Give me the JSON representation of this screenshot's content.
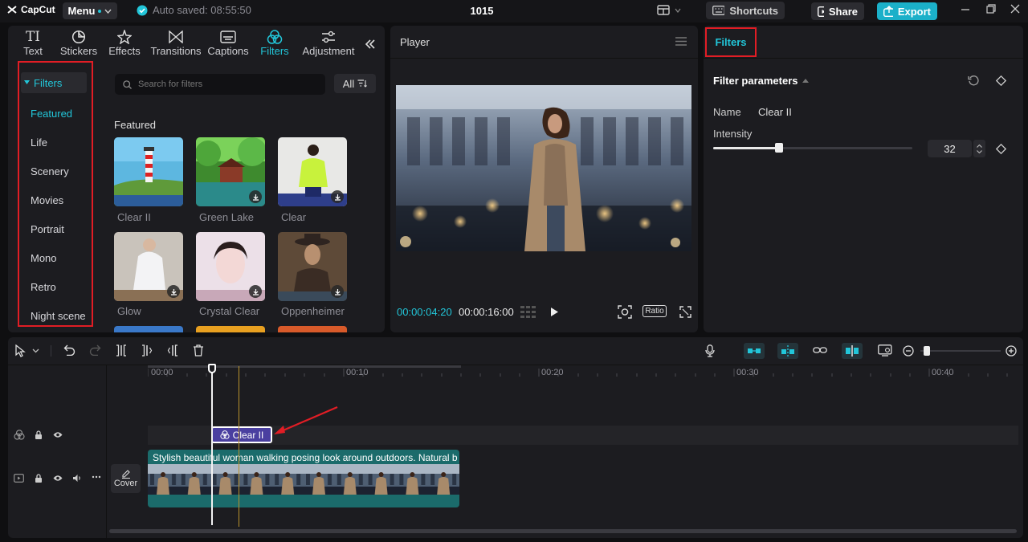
{
  "titlebar": {
    "app_name": "CapCut",
    "menu_label": "Menu",
    "autosave_text": "Auto saved: 08:55:50",
    "project_title": "1015",
    "shortcuts_label": "Shortcuts",
    "share_label": "Share",
    "export_label": "Export"
  },
  "category_tabs": [
    {
      "label": "Text",
      "icon": "text-icon"
    },
    {
      "label": "Stickers",
      "icon": "sticker-icon"
    },
    {
      "label": "Effects",
      "icon": "effects-icon"
    },
    {
      "label": "Transitions",
      "icon": "transitions-icon"
    },
    {
      "label": "Captions",
      "icon": "captions-icon"
    },
    {
      "label": "Filters",
      "icon": "filters-icon",
      "active": true
    },
    {
      "label": "Adjustment",
      "icon": "adjustment-icon"
    }
  ],
  "sidebar": {
    "header": "Filters",
    "items": [
      "Featured",
      "Life",
      "Scenery",
      "Movies",
      "Portrait",
      "Mono",
      "Retro",
      "Night scene"
    ],
    "active_item": "Featured"
  },
  "search": {
    "placeholder": "Search for filters"
  },
  "all_filter_label": "All",
  "section_label": "Featured",
  "filters": [
    {
      "label": "Clear II",
      "downloaded": true
    },
    {
      "label": "Green Lake",
      "downloaded": false
    },
    {
      "label": "Clear",
      "downloaded": false
    },
    {
      "label": "Glow",
      "downloaded": false
    },
    {
      "label": "Crystal Clear",
      "downloaded": false
    },
    {
      "label": "Oppenheimer",
      "downloaded": false
    }
  ],
  "player": {
    "title": "Player",
    "current_time": "00:00:04:20",
    "total_time": "00:00:16:00",
    "ratio_label": "Ratio"
  },
  "right_panel": {
    "tab_label": "Filters",
    "params_title": "Filter parameters",
    "name_label": "Name",
    "name_value": "Clear II",
    "intensity_label": "Intensity",
    "intensity_value": "32"
  },
  "timeline": {
    "ruler_labels": [
      "00:00",
      "00:10",
      "00:20",
      "00:30",
      "00:40"
    ],
    "filter_clip_label": "Clear II",
    "video_clip_caption": "Stylish beautiful woman walking posing look around outdoors. Natural b",
    "cover_label": "Cover"
  },
  "colors": {
    "accent": "#22c6d9",
    "highlight_box": "#e11d25",
    "filter_clip": "#4a3fa0",
    "video_clip": "#1b6b6b"
  }
}
